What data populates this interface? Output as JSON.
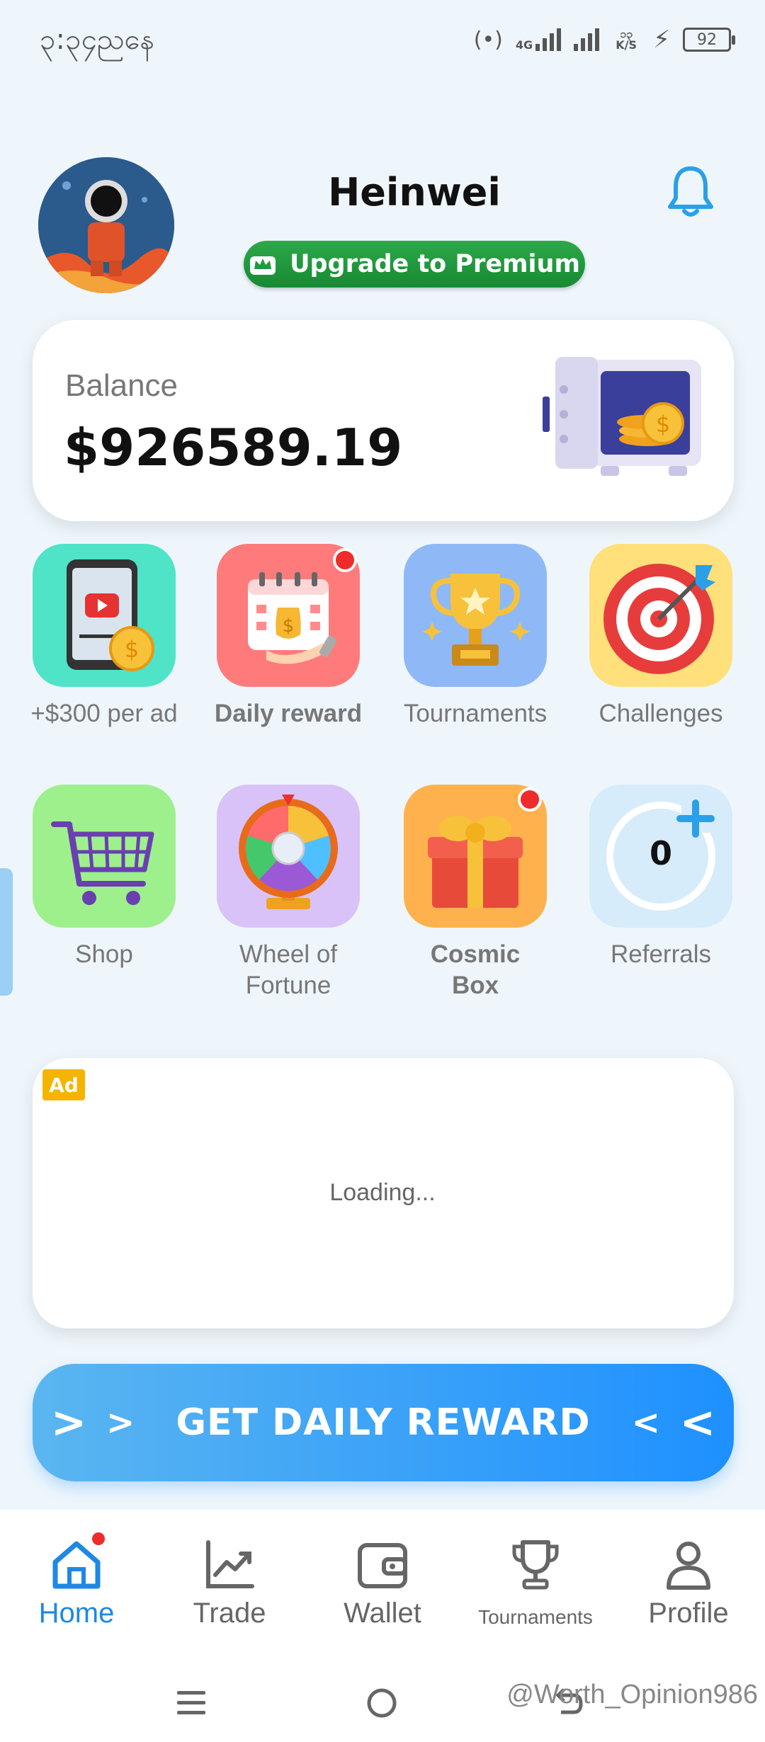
{
  "status_bar": {
    "time": "၃:၃၄ညနေ",
    "network": "4G",
    "speed": "၁၃ K/S",
    "battery": "92"
  },
  "header": {
    "username": "Heinwei",
    "premium_label": "Upgrade to Premium"
  },
  "balance": {
    "label": "Balance",
    "value": "$926589.19"
  },
  "features": [
    {
      "label": "+$300 per ad",
      "icon": "video-ad-icon",
      "color": "#4fe3c8"
    },
    {
      "label": "Daily reward",
      "icon": "calendar-money-icon",
      "color": "#ff7b7b",
      "badge": true
    },
    {
      "label": "Tournaments",
      "icon": "trophy-icon",
      "color": "#8fb8f7"
    },
    {
      "label": "Challenges",
      "icon": "target-icon",
      "color": "#ffe07a"
    },
    {
      "label": "Shop",
      "icon": "cart-icon",
      "color": "#9ef08c"
    },
    {
      "label": "Wheel of Fortune",
      "icon": "wheel-icon",
      "color": "#d9c2f7"
    },
    {
      "label": "Cosmic Box",
      "icon": "gift-icon",
      "color": "#ffb14d",
      "badge": true
    },
    {
      "label": "Referrals",
      "icon": "referral-icon",
      "color": "#d6ecfa",
      "count": "0"
    }
  ],
  "ad": {
    "badge": "Ad",
    "loading": "Loading..."
  },
  "cta": {
    "label": "GET DAILY REWARD"
  },
  "nav": {
    "items": [
      {
        "label": "Home",
        "icon": "home-icon",
        "active": true
      },
      {
        "label": "Trade",
        "icon": "chart-icon"
      },
      {
        "label": "Wallet",
        "icon": "wallet-icon"
      },
      {
        "label": "Tournaments",
        "icon": "trophy-outline-icon"
      },
      {
        "label": "Profile",
        "icon": "person-icon"
      }
    ]
  },
  "watermark": "@Worth_Opinion986",
  "colors": {
    "accent": "#1e88e5",
    "premium": "#1f9b3f",
    "badge": "#ef2b2b"
  }
}
